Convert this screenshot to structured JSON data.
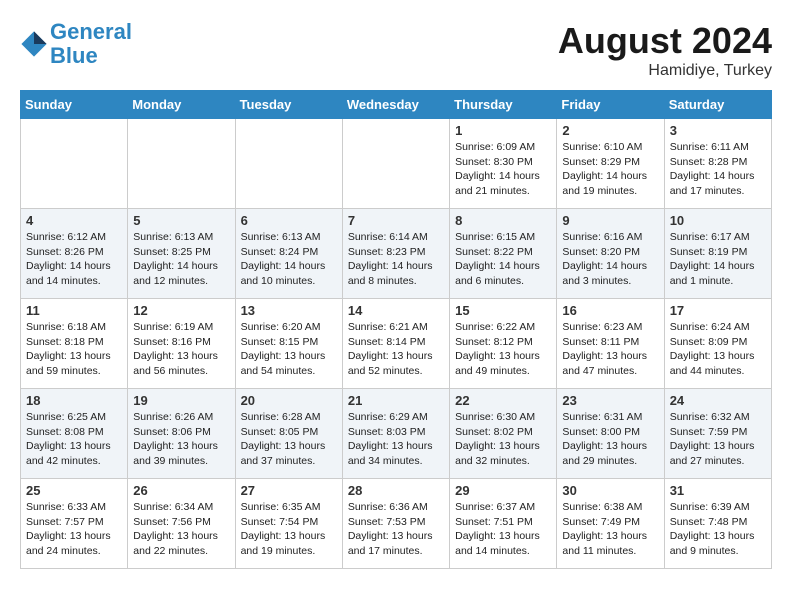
{
  "header": {
    "logo_line1": "General",
    "logo_line2": "Blue",
    "month_year": "August 2024",
    "location": "Hamidiye, Turkey"
  },
  "weekdays": [
    "Sunday",
    "Monday",
    "Tuesday",
    "Wednesday",
    "Thursday",
    "Friday",
    "Saturday"
  ],
  "weeks": [
    [
      {
        "day": null
      },
      {
        "day": null
      },
      {
        "day": null
      },
      {
        "day": null
      },
      {
        "day": 1,
        "sunrise": "6:09 AM",
        "sunset": "8:30 PM",
        "daylight": "14 hours and 21 minutes."
      },
      {
        "day": 2,
        "sunrise": "6:10 AM",
        "sunset": "8:29 PM",
        "daylight": "14 hours and 19 minutes."
      },
      {
        "day": 3,
        "sunrise": "6:11 AM",
        "sunset": "8:28 PM",
        "daylight": "14 hours and 17 minutes."
      }
    ],
    [
      {
        "day": 4,
        "sunrise": "6:12 AM",
        "sunset": "8:26 PM",
        "daylight": "14 hours and 14 minutes."
      },
      {
        "day": 5,
        "sunrise": "6:13 AM",
        "sunset": "8:25 PM",
        "daylight": "14 hours and 12 minutes."
      },
      {
        "day": 6,
        "sunrise": "6:13 AM",
        "sunset": "8:24 PM",
        "daylight": "14 hours and 10 minutes."
      },
      {
        "day": 7,
        "sunrise": "6:14 AM",
        "sunset": "8:23 PM",
        "daylight": "14 hours and 8 minutes."
      },
      {
        "day": 8,
        "sunrise": "6:15 AM",
        "sunset": "8:22 PM",
        "daylight": "14 hours and 6 minutes."
      },
      {
        "day": 9,
        "sunrise": "6:16 AM",
        "sunset": "8:20 PM",
        "daylight": "14 hours and 3 minutes."
      },
      {
        "day": 10,
        "sunrise": "6:17 AM",
        "sunset": "8:19 PM",
        "daylight": "14 hours and 1 minute."
      }
    ],
    [
      {
        "day": 11,
        "sunrise": "6:18 AM",
        "sunset": "8:18 PM",
        "daylight": "13 hours and 59 minutes."
      },
      {
        "day": 12,
        "sunrise": "6:19 AM",
        "sunset": "8:16 PM",
        "daylight": "13 hours and 56 minutes."
      },
      {
        "day": 13,
        "sunrise": "6:20 AM",
        "sunset": "8:15 PM",
        "daylight": "13 hours and 54 minutes."
      },
      {
        "day": 14,
        "sunrise": "6:21 AM",
        "sunset": "8:14 PM",
        "daylight": "13 hours and 52 minutes."
      },
      {
        "day": 15,
        "sunrise": "6:22 AM",
        "sunset": "8:12 PM",
        "daylight": "13 hours and 49 minutes."
      },
      {
        "day": 16,
        "sunrise": "6:23 AM",
        "sunset": "8:11 PM",
        "daylight": "13 hours and 47 minutes."
      },
      {
        "day": 17,
        "sunrise": "6:24 AM",
        "sunset": "8:09 PM",
        "daylight": "13 hours and 44 minutes."
      }
    ],
    [
      {
        "day": 18,
        "sunrise": "6:25 AM",
        "sunset": "8:08 PM",
        "daylight": "13 hours and 42 minutes."
      },
      {
        "day": 19,
        "sunrise": "6:26 AM",
        "sunset": "8:06 PM",
        "daylight": "13 hours and 39 minutes."
      },
      {
        "day": 20,
        "sunrise": "6:28 AM",
        "sunset": "8:05 PM",
        "daylight": "13 hours and 37 minutes."
      },
      {
        "day": 21,
        "sunrise": "6:29 AM",
        "sunset": "8:03 PM",
        "daylight": "13 hours and 34 minutes."
      },
      {
        "day": 22,
        "sunrise": "6:30 AM",
        "sunset": "8:02 PM",
        "daylight": "13 hours and 32 minutes."
      },
      {
        "day": 23,
        "sunrise": "6:31 AM",
        "sunset": "8:00 PM",
        "daylight": "13 hours and 29 minutes."
      },
      {
        "day": 24,
        "sunrise": "6:32 AM",
        "sunset": "7:59 PM",
        "daylight": "13 hours and 27 minutes."
      }
    ],
    [
      {
        "day": 25,
        "sunrise": "6:33 AM",
        "sunset": "7:57 PM",
        "daylight": "13 hours and 24 minutes."
      },
      {
        "day": 26,
        "sunrise": "6:34 AM",
        "sunset": "7:56 PM",
        "daylight": "13 hours and 22 minutes."
      },
      {
        "day": 27,
        "sunrise": "6:35 AM",
        "sunset": "7:54 PM",
        "daylight": "13 hours and 19 minutes."
      },
      {
        "day": 28,
        "sunrise": "6:36 AM",
        "sunset": "7:53 PM",
        "daylight": "13 hours and 17 minutes."
      },
      {
        "day": 29,
        "sunrise": "6:37 AM",
        "sunset": "7:51 PM",
        "daylight": "13 hours and 14 minutes."
      },
      {
        "day": 30,
        "sunrise": "6:38 AM",
        "sunset": "7:49 PM",
        "daylight": "13 hours and 11 minutes."
      },
      {
        "day": 31,
        "sunrise": "6:39 AM",
        "sunset": "7:48 PM",
        "daylight": "13 hours and 9 minutes."
      }
    ]
  ]
}
